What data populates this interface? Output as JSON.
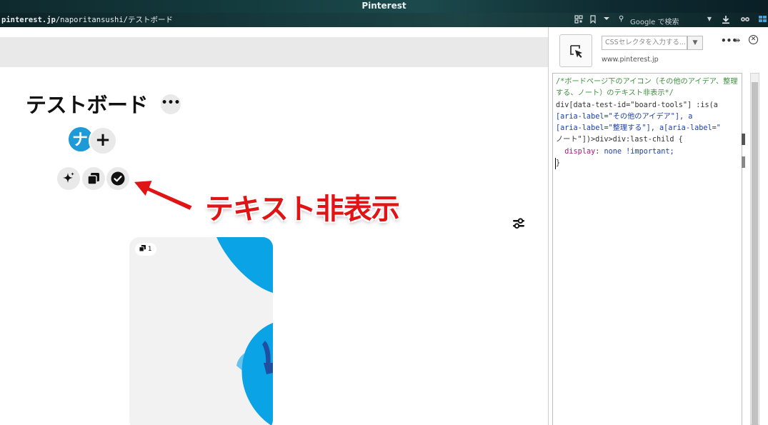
{
  "window": {
    "title": "Pinterest"
  },
  "addressbar": {
    "host": "pinterest.jp",
    "path": "/naporitansushi/テストボード"
  },
  "toolbar": {
    "search_engine_placeholder": "Google で検索",
    "qr_icon": "qr-code-icon",
    "bookmark_icon": "bookmark-icon",
    "download_icon": "download-icon"
  },
  "board": {
    "title": "テストボード",
    "more_label": "•••",
    "add_label": "+",
    "avatar_initial": "ナ",
    "tools": [
      {
        "name": "more-ideas",
        "icon": "sparkle-icon"
      },
      {
        "name": "organize",
        "icon": "copy-icon"
      },
      {
        "name": "notes",
        "icon": "check-circle-icon"
      }
    ],
    "pin_count": "1"
  },
  "annotation": {
    "text": "テキスト非表示",
    "color": "#e01414"
  },
  "devtools": {
    "selector_placeholder": "CSSセレクタを入力する...",
    "domain": "www.pinterest.jp",
    "code": {
      "comment": "/*ボードページ下のアイコン（その他のアイデア、整理する、ノート）のテキスト非表示*/",
      "line1": "div[data-test-id=\"board-tools\"] :is(a",
      "line2": "[aria-label=\"その他のアイデア\"], a",
      "line3": "[aria-label=\"整理する\"], a[aria-label=\"",
      "line4": "ノート\"])>div>div:last-child {",
      "prop": "display",
      "value": "none !important;",
      "close": "}"
    }
  },
  "colors": {
    "brand_blue": "#1e9ad6",
    "accent_red": "#e01414",
    "pin_blue": "#0aa3e6"
  }
}
